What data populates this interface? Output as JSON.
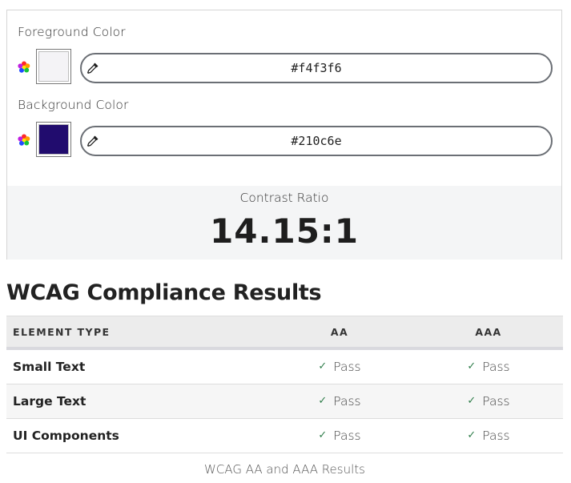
{
  "foreground": {
    "label": "Foreground Color",
    "swatch_color": "#f4f3f6",
    "hex_value": "#f4f3f6"
  },
  "background": {
    "label": "Background Color",
    "swatch_color": "#210c6e",
    "hex_value": "#210c6e"
  },
  "contrast": {
    "label": "Contrast Ratio",
    "value": "14.15:1"
  },
  "compliance": {
    "title": "WCAG Compliance Results",
    "headers": [
      "ELEMENT TYPE",
      "AA",
      "AAA"
    ],
    "rows": [
      {
        "type": "Small Text",
        "aa": "Pass",
        "aaa": "Pass"
      },
      {
        "type": "Large Text",
        "aa": "Pass",
        "aaa": "Pass"
      },
      {
        "type": "UI Components",
        "aa": "Pass",
        "aaa": "Pass"
      }
    ],
    "caption": "WCAG AA and AAA Results"
  },
  "icons": {
    "picker": "color-wheel-icon",
    "dropper": "eyedropper-icon",
    "check": "checkmark-icon"
  },
  "colors": {
    "pass_check": "#2f7d4a",
    "ratio_box_bg": "#f4f5f6"
  }
}
